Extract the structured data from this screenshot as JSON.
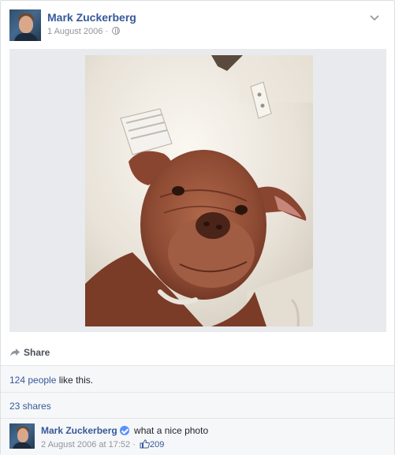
{
  "post": {
    "author": "Mark Zuckerberg",
    "date": "1 August 2006",
    "separator": "·",
    "privacy_icon": "globe-icon",
    "photo_alt": "Dog looking down at camera"
  },
  "actions": {
    "share_label": "Share"
  },
  "stats": {
    "likes_count": "124 people",
    "likes_suffix": " like this.",
    "shares": "23 shares"
  },
  "comment": {
    "author": "Mark Zuckerberg",
    "text": "what a nice photo",
    "timestamp": "2 August 2006 at 17:52",
    "separator": "·",
    "like_count": "209"
  },
  "colors": {
    "link": "#365899",
    "meta": "#90949c",
    "verified": "#5890ff"
  }
}
